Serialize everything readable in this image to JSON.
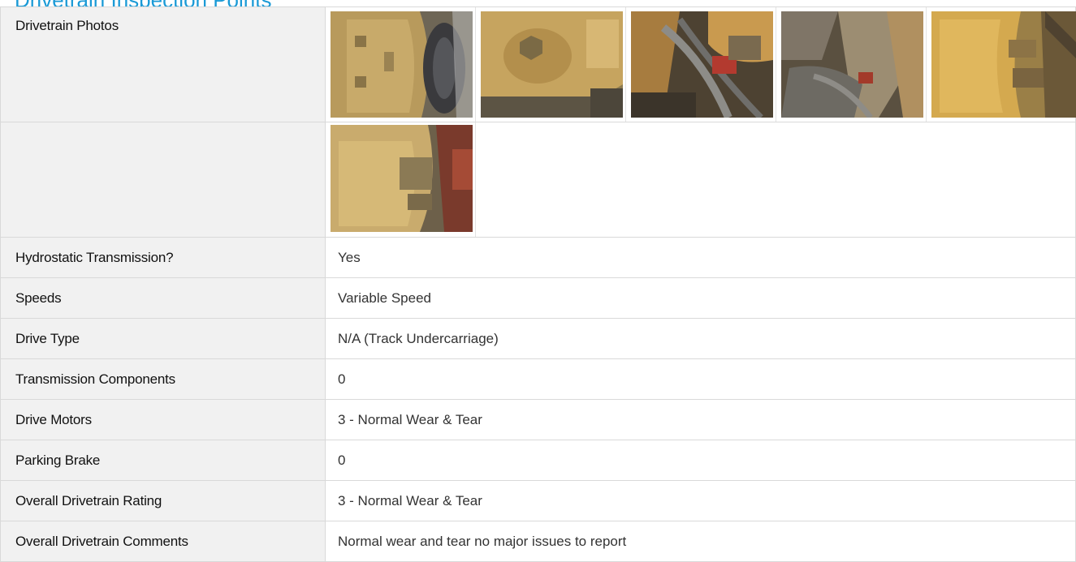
{
  "section_title": "Drivetrain Inspection Points",
  "photos": {
    "label": "Drivetrain Photos",
    "count": 6,
    "items": [
      {
        "name": "drivetrain-photo-1"
      },
      {
        "name": "drivetrain-photo-2"
      },
      {
        "name": "drivetrain-photo-3"
      },
      {
        "name": "drivetrain-photo-4"
      },
      {
        "name": "drivetrain-photo-5"
      },
      {
        "name": "drivetrain-photo-6"
      }
    ]
  },
  "rows": [
    {
      "label": "Hydrostatic Transmission?",
      "value": "Yes"
    },
    {
      "label": "Speeds",
      "value": "Variable Speed"
    },
    {
      "label": "Drive Type",
      "value": "N/A (Track Undercarriage)"
    },
    {
      "label": "Transmission Components",
      "value": "0"
    },
    {
      "label": "Drive Motors",
      "value": "3 - Normal Wear & Tear"
    },
    {
      "label": "Parking Brake",
      "value": "0"
    },
    {
      "label": "Overall Drivetrain Rating",
      "value": "3 - Normal Wear & Tear"
    },
    {
      "label": "Overall Drivetrain Comments",
      "value": "Normal wear and tear no major issues to report"
    }
  ],
  "colors": {
    "title": "#1a9ad6",
    "label_bg": "#f1f1f1",
    "border": "#d9d9d9"
  }
}
